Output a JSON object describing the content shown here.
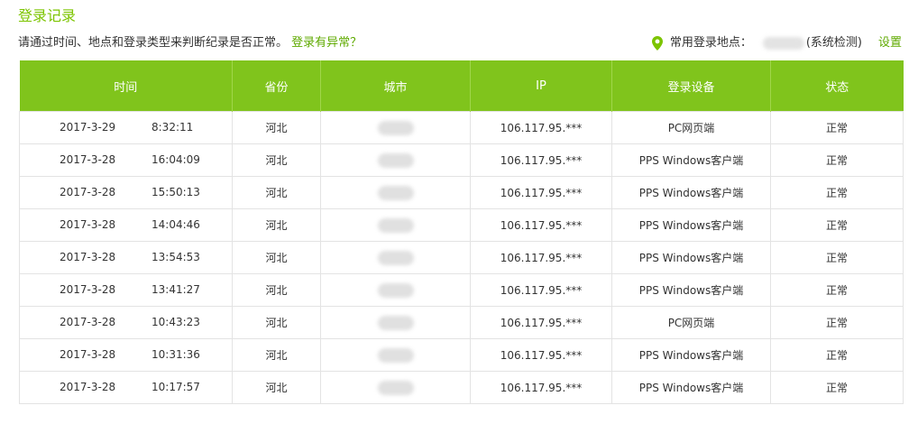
{
  "title": "登录记录",
  "description": "请通过时间、地点和登录类型来判断纪录是否正常。",
  "abnormal_link": "登录有异常？",
  "location": {
    "label": "常用登录地点：",
    "system_detected": "(系统检测)",
    "settings": "设置"
  },
  "colors": {
    "accent": "#7cc400",
    "header_bg": "#80c41c",
    "link": "#5faa00"
  },
  "columns": [
    "时间",
    "省份",
    "城市",
    "IP",
    "登录设备",
    "状态"
  ],
  "rows": [
    {
      "date": "2017-3-29",
      "time": "8:32:11",
      "province": "河北",
      "ip": "106.117.95.***",
      "device": "PC网页端",
      "status": "正常"
    },
    {
      "date": "2017-3-28",
      "time": "16:04:09",
      "province": "河北",
      "ip": "106.117.95.***",
      "device": "PPS Windows客户端",
      "status": "正常"
    },
    {
      "date": "2017-3-28",
      "time": "15:50:13",
      "province": "河北",
      "ip": "106.117.95.***",
      "device": "PPS Windows客户端",
      "status": "正常"
    },
    {
      "date": "2017-3-28",
      "time": "14:04:46",
      "province": "河北",
      "ip": "106.117.95.***",
      "device": "PPS Windows客户端",
      "status": "正常"
    },
    {
      "date": "2017-3-28",
      "time": "13:54:53",
      "province": "河北",
      "ip": "106.117.95.***",
      "device": "PPS Windows客户端",
      "status": "正常"
    },
    {
      "date": "2017-3-28",
      "time": "13:41:27",
      "province": "河北",
      "ip": "106.117.95.***",
      "device": "PPS Windows客户端",
      "status": "正常"
    },
    {
      "date": "2017-3-28",
      "time": "10:43:23",
      "province": "河北",
      "ip": "106.117.95.***",
      "device": "PC网页端",
      "status": "正常"
    },
    {
      "date": "2017-3-28",
      "time": "10:31:36",
      "province": "河北",
      "ip": "106.117.95.***",
      "device": "PPS Windows客户端",
      "status": "正常"
    },
    {
      "date": "2017-3-28",
      "time": "10:17:57",
      "province": "河北",
      "ip": "106.117.95.***",
      "device": "PPS Windows客户端",
      "status": "正常"
    }
  ]
}
